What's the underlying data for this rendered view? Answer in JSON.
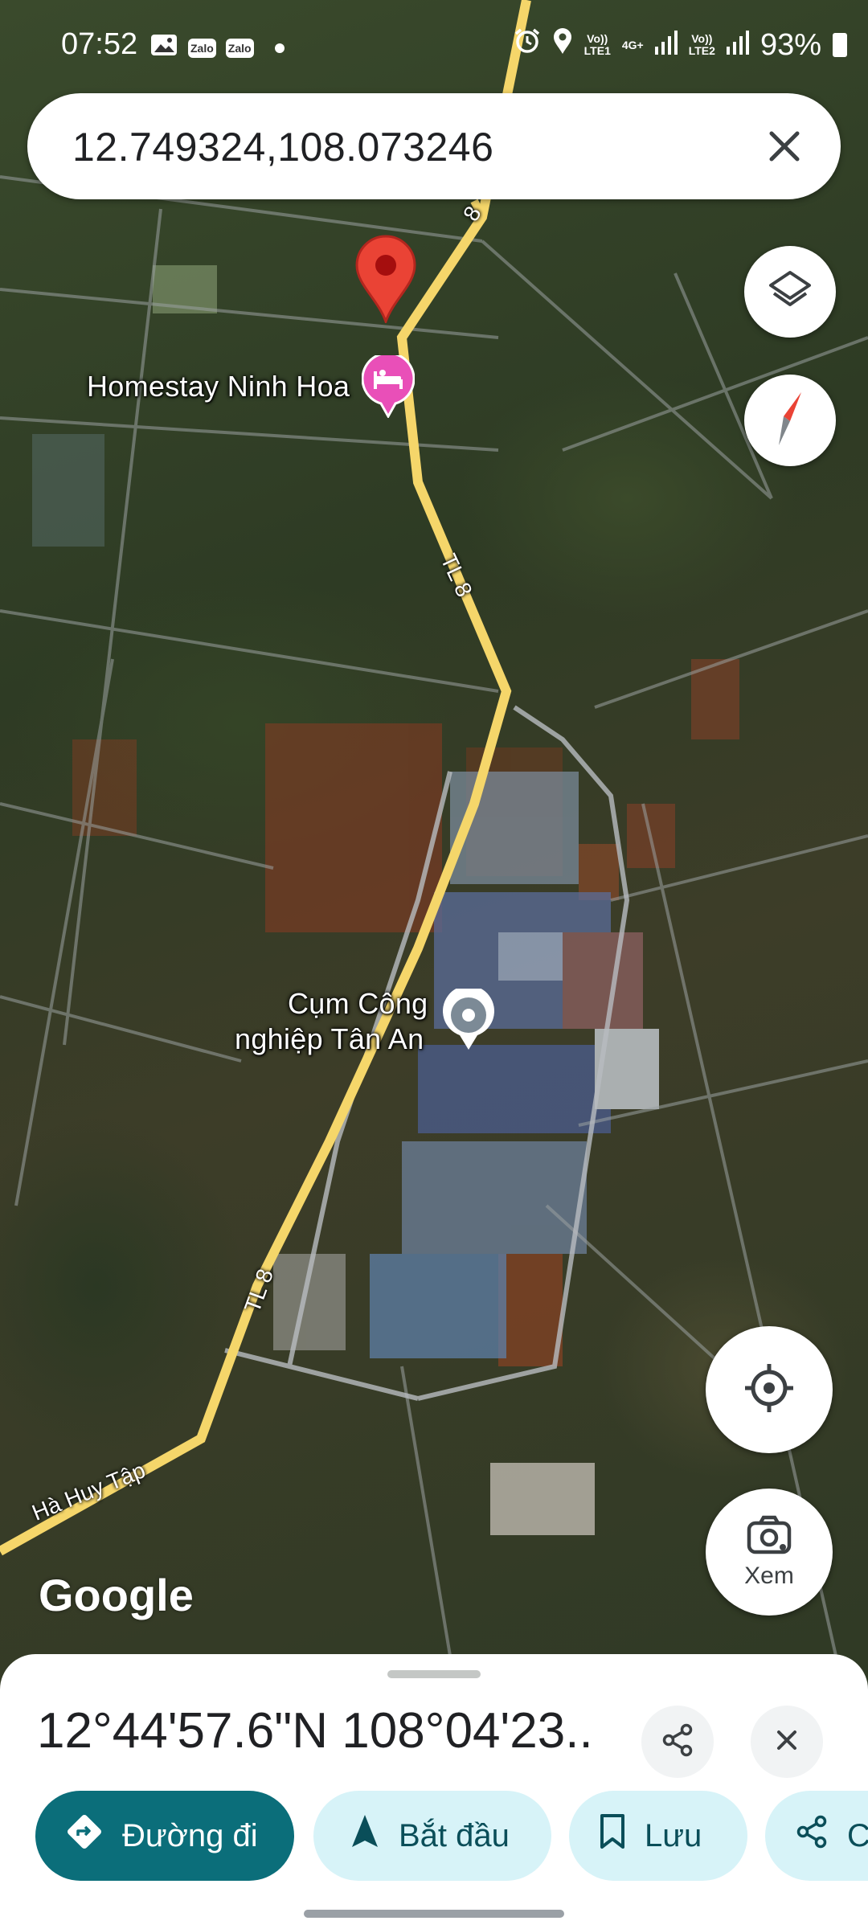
{
  "status_bar": {
    "time": "07:52",
    "notification_icons": [
      "image-icon",
      "zalo-icon",
      "zalo-icon"
    ],
    "zalo_label": "Zalo",
    "sim1_label": "Vo))\nLTE1",
    "sim1_tech": "4G+",
    "sim2_label": "Vo))\nLTE2",
    "battery": "93%"
  },
  "search": {
    "query": "12.749324,108.073246",
    "clear_icon": "close-icon"
  },
  "map": {
    "labels": {
      "homestay": "Homestay Ninh Hoa",
      "industrial_1": "Cụm Công",
      "industrial_2": "nghiệp Tân An",
      "road_tl8_top": "8",
      "road_tl8_mid": "TL 8",
      "road_tl8_low": "TL 8",
      "road_ha_huy_tap": "Hà Huy Tập"
    },
    "logo": "Google",
    "colors": {
      "pin": "#ea4335",
      "homestay_poi": "#e94fb8",
      "road": "#f5d66a"
    }
  },
  "map_controls": {
    "layers_icon": "layers-icon",
    "compass_icon": "compass-icon",
    "location_icon": "my-location-icon",
    "lens_label": "Xem"
  },
  "sheet": {
    "title": "12°44'57.6\"N 108°04'23....",
    "share_icon": "share-icon",
    "close_icon": "close-icon",
    "actions": [
      {
        "label": "Đường đi",
        "icon": "directions-icon"
      },
      {
        "label": "Bắt đầu",
        "icon": "navigation-arrow-icon"
      },
      {
        "label": "Lưu",
        "icon": "bookmark-icon"
      },
      {
        "label": "C",
        "icon": "share-icon"
      }
    ],
    "accent": "#0b6e7a",
    "chip_bg": "#d7f3f8"
  }
}
